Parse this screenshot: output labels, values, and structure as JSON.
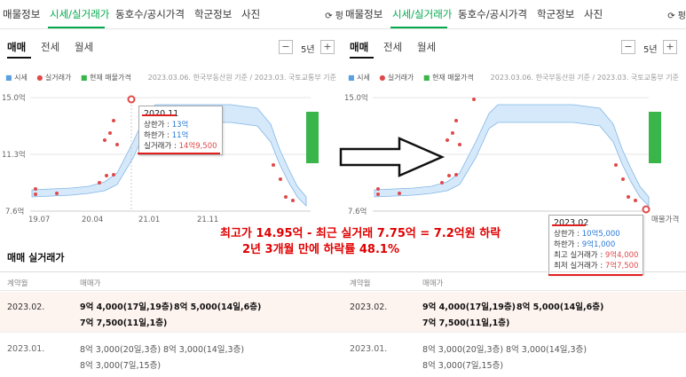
{
  "tabs": [
    "매물정보",
    "시세/실거래가",
    "동호수/공시가격",
    "학군정보",
    "사진"
  ],
  "refresh": "⟳ 펑",
  "subtabs": [
    "매매",
    "전세",
    "월세"
  ],
  "period": "5년",
  "minus": "−",
  "plus": "+",
  "legend": {
    "price": "시세",
    "deal": "실거래가",
    "listing": "현재 매물가격"
  },
  "source": "2023.03.06. 한국부동산원 기준 / 2023.03. 국토교통부 기준",
  "y_labels": [
    "15.0억",
    "11.3억",
    "7.6억"
  ],
  "x_labels": [
    "19.07",
    "20.04",
    "21.01",
    "21.11"
  ],
  "x_label_right": "매물가격",
  "tooltip_left": {
    "date": "2020.11",
    "upper_label": "상한가 : ",
    "upper_value": "13억",
    "lower_label": "하한가 : ",
    "lower_value": "11억",
    "deal_label": "실거래가 : ",
    "deal_value": "14억9,500"
  },
  "tooltip_right": {
    "date": "2023.02",
    "upper_label": "상한가 : ",
    "upper_value": "10억5,000",
    "lower_label": "하한가 : ",
    "lower_value": "9억1,000",
    "max_label": "최고 실거래가 : ",
    "max_value": "9억4,000",
    "min_label": "최저 실거래가 : ",
    "min_value": "7억7,500"
  },
  "section_title": "매매 실거래가",
  "table_headers": [
    "계약월",
    "매매가"
  ],
  "rows": [
    {
      "date": "2023.02.",
      "deals": [
        "9억 4,000(17일,19층)",
        "8억 5,000(14일,6층)",
        "7억 7,500(11일,1층)"
      ]
    },
    {
      "date": "2023.01.",
      "deals": [
        "8억 3,000(20일,3층)",
        "8억 3,000(14일,3층)",
        "8억 3,000(7일,15층)"
      ]
    }
  ],
  "annotation": {
    "line1": "최고가 14.95억 - 최근 실거래 7.75억 = 7.2억원 하락",
    "line2": "2년 3개월 만에 하락률 48.1%"
  },
  "colors": {
    "accent": "#03a94d",
    "band": "#d6e9fa",
    "band_line": "#7fb5e6",
    "deal": "#e0494a",
    "listing": "#3ab54a",
    "annotation": "#e00000"
  }
}
